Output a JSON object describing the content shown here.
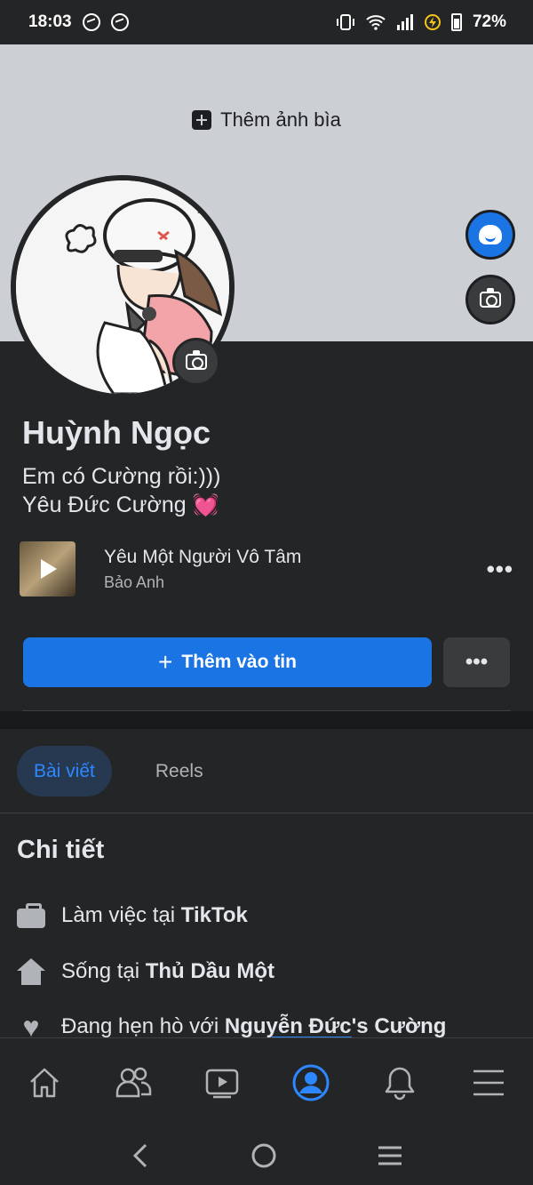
{
  "status_bar": {
    "time": "18:03",
    "battery": "72%",
    "left_icons": [
      "messenger-icon",
      "messenger-icon"
    ],
    "right_icons": [
      "vibrate-icon",
      "wifi-icon",
      "signal-icon",
      "charging-icon",
      "battery-icon"
    ]
  },
  "cover": {
    "add_cover_label": "Thêm ảnh bìa"
  },
  "profile": {
    "name": "Huỳnh Ngọc",
    "bio_line1": "Em có Cường rồi:)))",
    "bio_line2": "Yêu Đức Cường",
    "bio_emoji": "💓"
  },
  "music": {
    "title": "Yêu Một Người Vô Tâm",
    "artist": "Bảo Anh",
    "more": "•••"
  },
  "actions": {
    "add_story_icon": "+",
    "add_story_label": "Thêm vào tin",
    "more_label": "•••"
  },
  "tabs": [
    {
      "label": "Bài viết",
      "active": true
    },
    {
      "label": "Reels",
      "active": false
    }
  ],
  "details": {
    "title": "Chi tiết",
    "work_prefix": "Làm việc tại ",
    "work_value": "TikTok",
    "live_prefix": "Sống tại ",
    "live_value": "Thủ Dầu Một",
    "relationship_prefix": "Đang hẹn hò với ",
    "relationship_value": "Nguyễn Đức's Cường"
  },
  "bottom_nav": [
    "home-icon",
    "friends-icon",
    "video-icon",
    "profile-icon",
    "bell-icon",
    "menu-icon"
  ],
  "colors": {
    "accent": "#1b74e4",
    "active_tab": "#2d88ff",
    "background": "#242526",
    "cover": "#ccd0d5"
  }
}
